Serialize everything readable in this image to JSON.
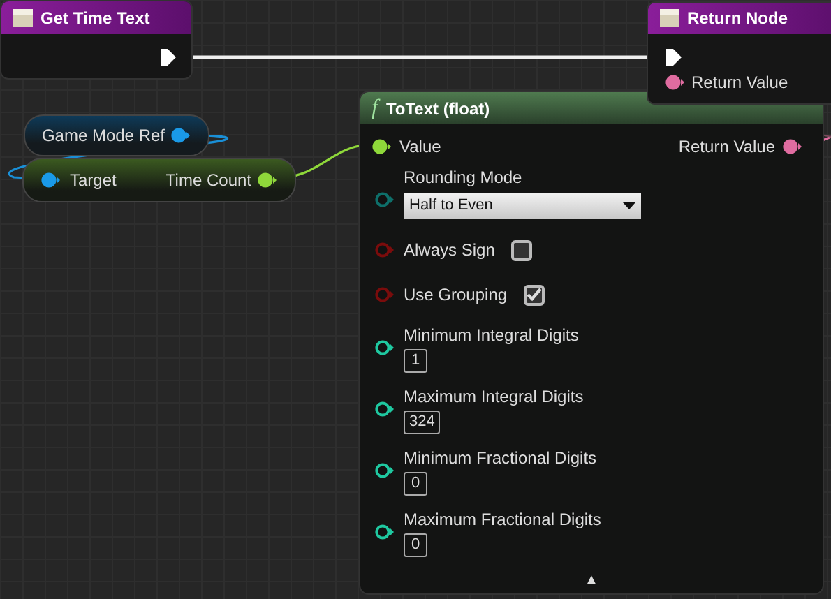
{
  "get_time_text": {
    "title": "Get Time Text"
  },
  "return_node": {
    "title": "Return Node",
    "pin": "Return Value"
  },
  "game_mode_ref": {
    "label": "Game Mode Ref"
  },
  "time_count_getter": {
    "input": "Target",
    "output": "Time Count"
  },
  "to_text": {
    "icon": "f",
    "title": "ToText (float)",
    "input": "Value",
    "output": "Return Value",
    "params": [
      {
        "kind": "dropdown",
        "label": "Rounding Mode",
        "value": "Half to Even"
      },
      {
        "kind": "checkbox",
        "label": "Always Sign",
        "checked": false
      },
      {
        "kind": "checkbox",
        "label": "Use Grouping",
        "checked": true
      },
      {
        "kind": "number",
        "label": "Minimum Integral Digits",
        "value": "1"
      },
      {
        "kind": "number",
        "label": "Maximum Integral Digits",
        "value": "324"
      },
      {
        "kind": "number",
        "label": "Minimum Fractional Digits",
        "value": "0"
      },
      {
        "kind": "number",
        "label": "Maximum Fractional Digits",
        "value": "0"
      }
    ],
    "collapse_arrow": "▲"
  }
}
